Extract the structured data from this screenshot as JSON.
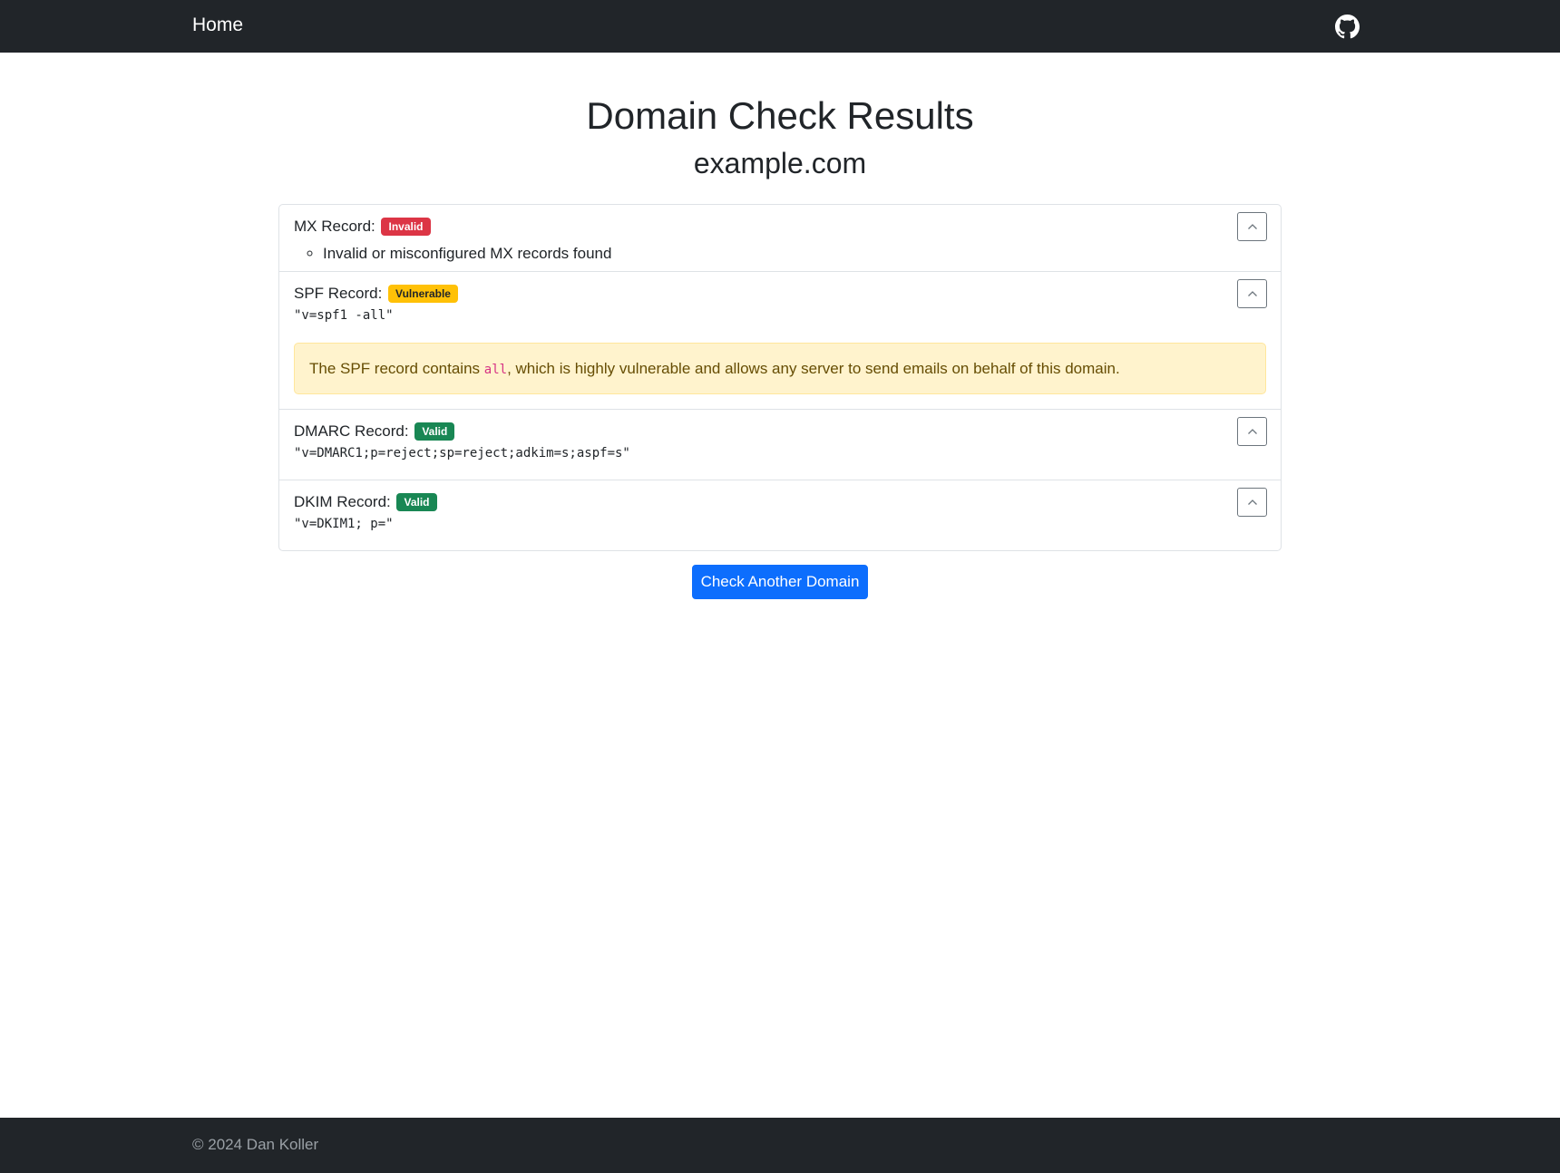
{
  "navbar": {
    "home_label": "Home",
    "github_icon": "github-icon"
  },
  "header": {
    "title": "Domain Check Results",
    "domain": "example.com"
  },
  "records": {
    "mx": {
      "label": "MX Record:",
      "status": "Invalid",
      "status_color": "#dc3545",
      "issues": [
        "Invalid or misconfigured MX records found"
      ]
    },
    "spf": {
      "label": "SPF Record:",
      "status": "Vulnerable",
      "status_color": "#ffc107",
      "value": "\"v=spf1 -all\"",
      "alert": {
        "before": "The SPF record contains ",
        "code": "all",
        "after": ", which is highly vulnerable and allows any server to send emails on behalf of this domain."
      }
    },
    "dmarc": {
      "label": "DMARC Record:",
      "status": "Valid",
      "status_color": "#198754",
      "value": "\"v=DMARC1;p=reject;sp=reject;adkim=s;aspf=s\""
    },
    "dkim": {
      "label": "DKIM Record:",
      "status": "Valid",
      "status_color": "#198754",
      "value": "\"v=DKIM1; p=\""
    }
  },
  "actions": {
    "check_another_label": "Check Another Domain",
    "primary_color": "#0d6efd"
  },
  "footer": {
    "copyright": "© 2024 Dan Koller"
  }
}
